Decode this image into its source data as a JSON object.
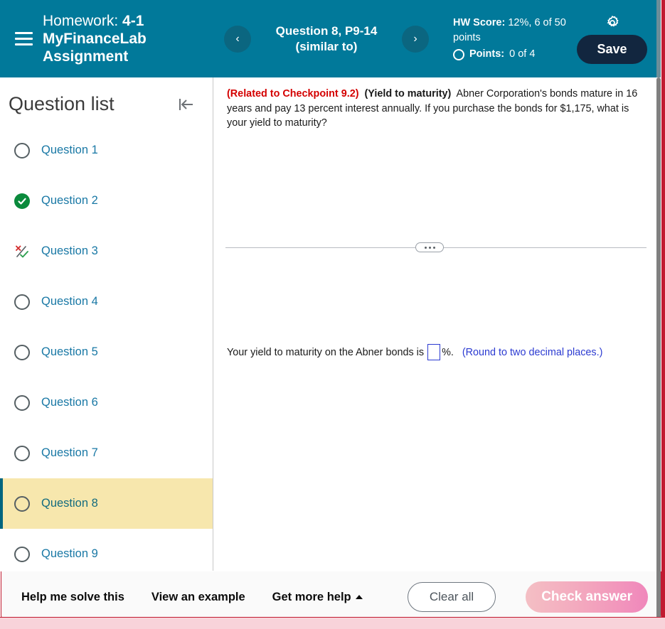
{
  "header": {
    "menu_icon": "hamburger-menu-icon",
    "homework_label": "Homework:",
    "homework_value": "4-1 MyFinanceLab Assignment",
    "prev_icon": "chevron-left-icon",
    "next_icon": "chevron-right-icon",
    "question_nav_title": "Question 8, P9-14",
    "question_nav_subtitle": "(similar to)",
    "hw_score_label": "HW Score:",
    "hw_score_value": "12%, 6 of 50 points",
    "points_label": "Points:",
    "points_value": "0 of 4",
    "settings_icon": "gear-icon",
    "save_label": "Save",
    "bg_color": "#01799a",
    "save_bg_color": "#12263f"
  },
  "sidebar": {
    "title": "Question list",
    "collapse_icon": "collapse-panel-left-icon",
    "active_bg_color": "#f7e7ad",
    "active_border_color": "#00657f",
    "link_color": "#1978a5",
    "items": [
      {
        "label": "Question 1",
        "status": "unanswered",
        "icon": "empty-circle-icon",
        "active": false
      },
      {
        "label": "Question 2",
        "status": "correct",
        "icon": "green-check-circle-icon",
        "active": false
      },
      {
        "label": "Question 3",
        "status": "partial",
        "icon": "partial-credit-icon",
        "active": false
      },
      {
        "label": "Question 4",
        "status": "unanswered",
        "icon": "empty-circle-icon",
        "active": false
      },
      {
        "label": "Question 5",
        "status": "unanswered",
        "icon": "empty-circle-icon",
        "active": false
      },
      {
        "label": "Question 6",
        "status": "unanswered",
        "icon": "empty-circle-icon",
        "active": false
      },
      {
        "label": "Question 7",
        "status": "unanswered",
        "icon": "empty-circle-icon",
        "active": false
      },
      {
        "label": "Question 8",
        "status": "unanswered",
        "icon": "empty-circle-icon",
        "active": true
      },
      {
        "label": "Question 9",
        "status": "unanswered",
        "icon": "empty-circle-icon",
        "active": false
      }
    ]
  },
  "main": {
    "checkpoint_ref": "(Related to Checkpoint 9.2)",
    "topic": "(Yield to maturity)",
    "body": "Abner Corporation's bonds mature in 16 years and pay 13 percent interest annually.  If you purchase the bonds for $1,175, what is your yield to maturity?",
    "splitter_icon": "resize-handle-dots-icon",
    "answer_prompt": "Your yield to maturity on the Abner bonds is",
    "answer_value": "",
    "answer_placeholder": "",
    "answer_unit": "%.",
    "rounding_hint": "(Round to two decimal places.)",
    "ref_color": "#d40000",
    "hint_color": "#2b3ad1"
  },
  "bottombar": {
    "help_solve_label": "Help me solve this",
    "view_example_label": "View an example",
    "get_more_help_label": "Get more help",
    "get_more_help_icon": "caret-up-icon",
    "clear_all_label": "Clear all",
    "check_answer_label": "Check answer",
    "check_answer_disabled": true,
    "accent_color": "#c11a30"
  },
  "chrome": {
    "scrollbar_icon": "vertical-scrollbar",
    "border_color": "#c11a30"
  }
}
